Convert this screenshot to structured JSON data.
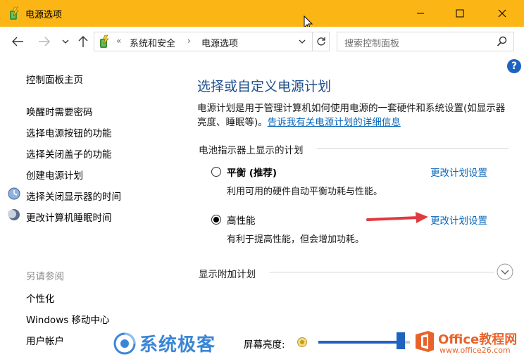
{
  "window": {
    "title": "电源选项"
  },
  "address": {
    "overflow": "«",
    "crumb1": "系统和安全",
    "separator": "›",
    "crumb2": "电源选项"
  },
  "search": {
    "placeholder": "搜索控制面板"
  },
  "help": {
    "label": "?"
  },
  "sidebar": {
    "home": "控制面板主页",
    "links": [
      "唤醒时需要密码",
      "选择电源按钮的功能",
      "选择关闭盖子的功能",
      "创建电源计划",
      "选择关闭显示器的时间",
      "更改计算机睡眠时间"
    ],
    "see_also_title": "另请参阅",
    "see_also": [
      "个性化",
      "Windows 移动中心",
      "用户帐户"
    ]
  },
  "main": {
    "heading": "选择或自定义电源计划",
    "description": "电源计划是用于管理计算机如何使用电源的一套硬件和系统设置(如显示器亮度、睡眠等)。",
    "description_link": "告诉我有关电源计划的详细信息",
    "group_label": "电池指示器上显示的计划",
    "plans": [
      {
        "name": "平衡 (推荐)",
        "description": "利用可用的硬件自动平衡功耗与性能。",
        "link": "更改计划设置",
        "selected": false
      },
      {
        "name": "高性能",
        "description": "有利于提高性能，但会增加功耗。",
        "link": "更改计划设置",
        "selected": true
      }
    ],
    "additional_plans": "显示附加计划"
  },
  "bottom": {
    "brightness_label": "屏幕亮度:",
    "brightness_level": 0.85
  },
  "watermarks": {
    "left_text": "系统极客",
    "right_name": "Office教程网",
    "right_url": "www.office26.com"
  },
  "colors": {
    "titlebar": "#fbb615",
    "link": "#0a67b8",
    "heading": "#1e4e8c",
    "accent": "#1f63c0",
    "arrow": "#e0393e"
  }
}
